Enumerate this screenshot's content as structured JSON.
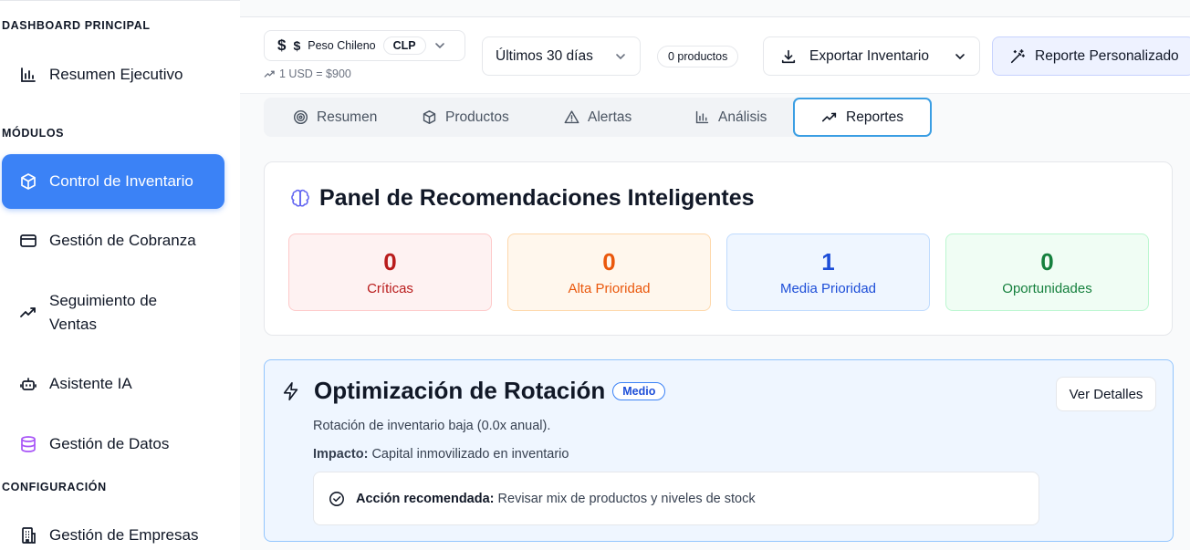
{
  "sidebar": {
    "sections": [
      {
        "title": "DASHBOARD PRINCIPAL"
      },
      {
        "title": "MÓDULOS"
      },
      {
        "title": "CONFIGURACIÓN"
      }
    ],
    "items": [
      {
        "label": "Resumen Ejecutivo",
        "icon": "bar-chart-icon"
      },
      {
        "label": "Control de Inventario",
        "icon": "box-icon",
        "active": true
      },
      {
        "label": "Gestión de Cobranza",
        "icon": "credit-card-icon"
      },
      {
        "label": "Seguimiento de Ventas",
        "label_line1": "Seguimiento de",
        "label_line2": "Ventas",
        "icon": "trending-up-icon"
      },
      {
        "label": "Asistente IA",
        "icon": "robot-icon"
      },
      {
        "label": "Gestión de Datos",
        "icon": "database-icon"
      },
      {
        "label": "Gestión de Empresas",
        "icon": "building-icon"
      }
    ]
  },
  "topbar": {
    "currency_symbol": "$",
    "currency_name": "Peso Chileno",
    "currency_code": "CLP",
    "exchange_rate": "1 USD = $900",
    "period": "Últimos 30 días",
    "products_count": "0 productos",
    "export_label": "Exportar Inventario",
    "custom_report_label": "Reporte Personalizado"
  },
  "tabs": [
    {
      "label": "Resumen",
      "icon": "target-icon"
    },
    {
      "label": "Productos",
      "icon": "package-icon"
    },
    {
      "label": "Alertas",
      "icon": "alert-triangle-icon"
    },
    {
      "label": "Análisis",
      "icon": "bar-chart-icon"
    },
    {
      "label": "Reportes",
      "icon": "trending-up-icon",
      "active": true
    }
  ],
  "panel": {
    "title": "Panel de Recomendaciones Inteligentes",
    "stats": [
      {
        "value": "0",
        "label": "Críticas",
        "color": "#b91c1c"
      },
      {
        "value": "0",
        "label": "Alta Prioridad",
        "color": "#ea580c"
      },
      {
        "value": "1",
        "label": "Media Prioridad",
        "color": "#1d4ed8"
      },
      {
        "value": "0",
        "label": "Oportunidades",
        "color": "#15803d"
      }
    ]
  },
  "recommendation": {
    "title": "Optimización de Rotación",
    "badge": "Medio",
    "details_button": "Ver Detalles",
    "description": "Rotación de inventario baja (0.0x anual).",
    "impact_label": "Impacto:",
    "impact_text": "Capital inmovilizado en inventario",
    "action_label": "Acción recomendada:",
    "action_text": "Revisar mix de productos y niveles de stock"
  },
  "colors": {
    "accent": "#3b82f6",
    "active_tab_border": "#3b9ee3"
  }
}
